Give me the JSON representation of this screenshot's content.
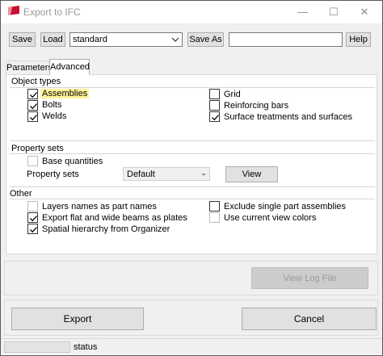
{
  "window": {
    "title": "Export to IFC",
    "minimize_glyph": "—",
    "maximize_glyph": "☐",
    "close_glyph": "✕"
  },
  "toolbar": {
    "save_label": "Save",
    "load_label": "Load",
    "preset_value": "standard",
    "save_as_label": "Save As",
    "save_as_name_value": "",
    "help_label": "Help"
  },
  "tabs": [
    {
      "label": "Parameters",
      "active": false
    },
    {
      "label": "Advanced",
      "active": true
    }
  ],
  "object_types": {
    "heading": "Object types",
    "items": [
      {
        "label": "Assemblies",
        "checked": true,
        "highlighted": true
      },
      {
        "label": "Bolts",
        "checked": true
      },
      {
        "label": "Welds",
        "checked": true
      },
      {
        "label": "Grid",
        "checked": false
      },
      {
        "label": "Reinforcing bars",
        "checked": false
      },
      {
        "label": "Surface treatments and surfaces",
        "checked": true
      }
    ]
  },
  "property_sets": {
    "heading": "Property sets",
    "base_quantities_label": "Base quantities",
    "base_quantities_checked": false,
    "property_sets_label": "Property sets",
    "property_sets_value": "Default",
    "view_label": "View"
  },
  "other": {
    "heading": "Other",
    "items": [
      {
        "label": "Layers names as part names",
        "checked": false,
        "enabled": true
      },
      {
        "label": "Export flat and wide beams as plates",
        "checked": true,
        "enabled": true
      },
      {
        "label": "Spatial hierarchy from Organizer",
        "checked": true,
        "enabled": true
      },
      {
        "label": "Exclude single part assemblies",
        "checked": false,
        "enabled": true
      },
      {
        "label": "Use current view colors",
        "checked": false,
        "enabled": false
      }
    ]
  },
  "view_log_label": "View Log File",
  "export_label": "Export",
  "cancel_label": "Cancel",
  "status_text": "status",
  "colors": {
    "highlight": "#fff49c",
    "app_icon": "#c8102e"
  }
}
